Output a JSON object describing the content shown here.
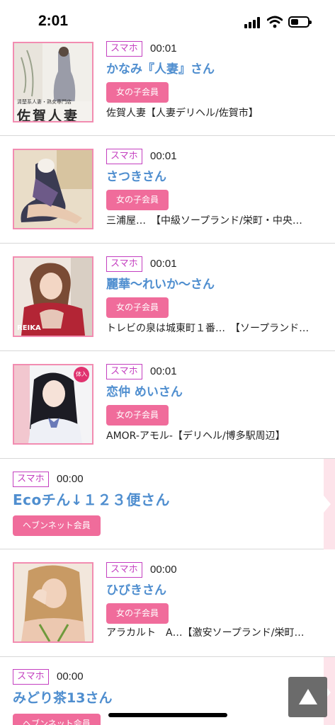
{
  "status_bar": {
    "time": "2:01"
  },
  "labels": {
    "smartphone": "スマホ"
  },
  "entries": [
    {
      "time": "00:01",
      "name": "かなみ『人妻』さん",
      "member": "女の子会員",
      "shop": "佐賀人妻【人妻デリヘル/佐賀市】",
      "thumb_text": "佐賀人妻",
      "thumb_subtext": "清楚系人妻・熟女専門店"
    },
    {
      "time": "00:01",
      "name": "さつきさん",
      "member": "女の子会員",
      "shop": "三浦屋…　【中級ソープランド/栄町・中央…"
    },
    {
      "time": "00:01",
      "name": "麗華〜れいか〜さん",
      "member": "女の子会員",
      "shop": "トレビの泉は城東町１番…　【ソープランド…",
      "thumb_text": "REIKA"
    },
    {
      "time": "00:01",
      "name": "恋仲 めいさん",
      "member": "女の子会員",
      "shop": "AMOR-アモル-【デリヘル/博多駅周辺】",
      "thumb_text": "体入"
    },
    {
      "time": "00:00",
      "name": "Ecoチん↓１２３便さん",
      "member": "ヘブンネット会員"
    },
    {
      "time": "00:00",
      "name": "ひびきさん",
      "member": "女の子会員",
      "shop": "アラカルト　A…【激安ソープランド/栄町…"
    },
    {
      "time": "00:00",
      "name": "みどり茶13さん",
      "member": "ヘブンネット会員"
    }
  ],
  "colors": {
    "name": "#4f8ecf",
    "badge": "#c43fc0",
    "member": "#f06c9b",
    "thumb_border": "#f28cb1"
  },
  "icons": {
    "scroll_top": "triangle-up-icon"
  }
}
